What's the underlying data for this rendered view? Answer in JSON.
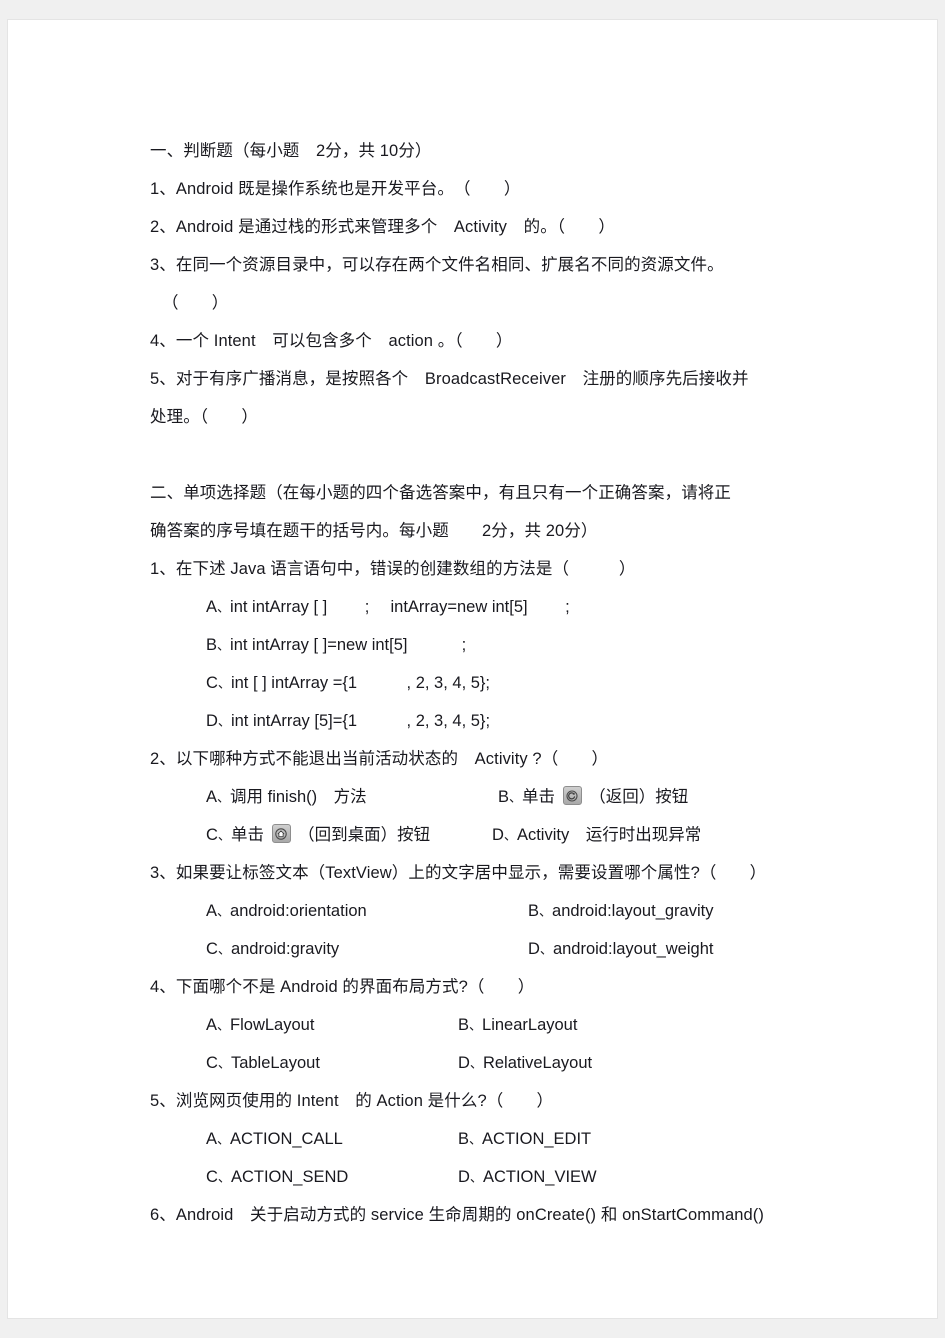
{
  "document": {
    "background_color": "#f0f0f0",
    "page_color": "#ffffff",
    "text_color": "#19191f"
  },
  "section1": {
    "heading": "一、判断题（每小题　2分，共 10分）",
    "items": [
      "1、Android 既是操作系统也是开发平台。　（　　）",
      "2、Android 是通过栈的形式来管理多个　Activity　的。（　　）",
      "3、在同一个资源目录中，可以存在两个文件名相同、扩展名不同的资源文件。",
      "（　　）",
      "4、一个 Intent　可以包含多个　action 。（　　）",
      "5、对于有序广播消息，是按照各个　BroadcastReceiver　注册的顺序先后接收并",
      "处理。（　　）"
    ]
  },
  "section2": {
    "heading_line1": "二、单项选择题（在每小题的四个备选答案中，有且只有一个正确答案，请将正",
    "heading_line2": "确答案的序号填在题干的括号内。每小题　　2分，共 20分）",
    "questions": [
      {
        "stem": "1、在下述 Java 语言语句中，错误的创建数组的方法是（　　　）",
        "layout": "stacked",
        "options": [
          {
            "letter": "A",
            "text": "int intArray [ ]　　 ;　 intArray=new int[5]　　 ;"
          },
          {
            "letter": "B",
            "text": "int intArray [ ]=new int[5]　　　 ;"
          },
          {
            "letter": "C",
            "text": "int [ ] intArray ={1　　　, 2, 3, 4, 5};"
          },
          {
            "letter": "D",
            "text": "int intArray [5]={1　　　, 2, 3, 4, 5};"
          }
        ]
      },
      {
        "stem": "2、以下哪种方式不能退出当前活动状态的　Activity ?（　　）",
        "layout": "two-column",
        "options": [
          {
            "letter": "A",
            "text": "调用 finish()　方法",
            "icon": ""
          },
          {
            "letter": "B",
            "text_before": "单击 ",
            "icon": "back-icon",
            "text_after": " （返回）按钮"
          },
          {
            "letter": "C",
            "text_before": "单击 ",
            "icon": "home-icon",
            "text_after": " （回到桌面）按钮"
          },
          {
            "letter": "D",
            "text": "Activity　运行时出现异常",
            "icon": ""
          }
        ]
      },
      {
        "stem": "3、如果要让标签文本（TextView）上的文字居中显示，需要设置哪个属性?（　　）",
        "layout": "two-column",
        "options": [
          {
            "letter": "A",
            "text": "android:orientation"
          },
          {
            "letter": "B",
            "text": "android:layout_gravity"
          },
          {
            "letter": "C",
            "text": "android:gravity"
          },
          {
            "letter": "D",
            "text": "android:layout_weight"
          }
        ]
      },
      {
        "stem": "4、下面哪个不是 Android 的界面布局方式?（　　）",
        "layout": "two-column",
        "options": [
          {
            "letter": "A",
            "text": "FlowLayout"
          },
          {
            "letter": "B",
            "text": "LinearLayout"
          },
          {
            "letter": "C",
            "text": "TableLayout"
          },
          {
            "letter": "D",
            "text": "RelativeLayout"
          }
        ]
      },
      {
        "stem": "5、浏览网页使用的 Intent　的 Action 是什么?（　　）",
        "layout": "two-column",
        "options": [
          {
            "letter": "A",
            "text": "ACTION_CALL"
          },
          {
            "letter": "B",
            "text": "ACTION_EDIT"
          },
          {
            "letter": "C",
            "text": "ACTION_SEND"
          },
          {
            "letter": "D",
            "text": "ACTION_VIEW"
          }
        ]
      },
      {
        "stem": "6、Android　关于启动方式的 service 生命周期的 onCreate() 和 onStartCommand()",
        "layout": "truncated",
        "options": []
      }
    ]
  }
}
